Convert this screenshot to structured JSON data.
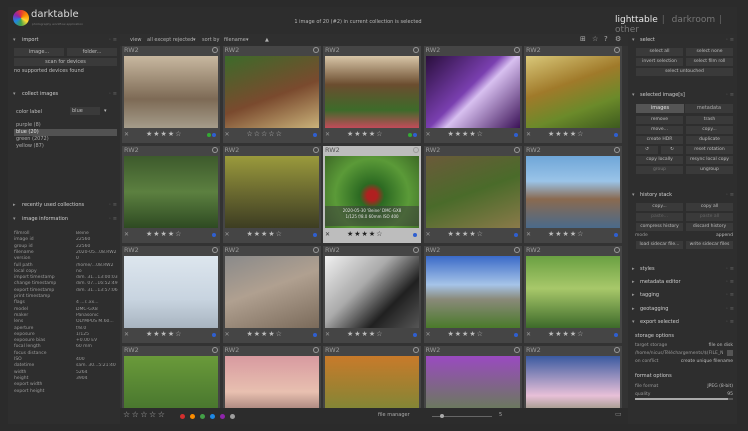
{
  "app": {
    "name": "darktable",
    "tagline": "photography workflow application"
  },
  "status_text": "1 image of 20 (#2) in current collection is selected",
  "views": [
    "lighttable",
    "darkroom",
    "other"
  ],
  "left": {
    "import": {
      "title": "import",
      "image_btn": "image...",
      "folder_btn": "folder...",
      "scan_btn": "scan for devices",
      "note": "no supported devices found"
    },
    "collect": {
      "title": "collect images",
      "mode": "color label",
      "value": "blue",
      "items": [
        "purple (8)",
        "blue (20)",
        "green (2072)",
        "yellow (87)"
      ]
    },
    "recent": {
      "title": "recently used collections"
    },
    "info": {
      "title": "image information",
      "rows": [
        [
          "filmroll",
          "Beine"
        ],
        [
          "image id",
          "22560"
        ],
        [
          "group id",
          "22560"
        ],
        [
          "filename",
          "2020-05...08.RW2"
        ],
        [
          "version",
          "0"
        ],
        [
          "full path",
          "/home/...08.RW2"
        ],
        [
          "local copy",
          "no"
        ],
        [
          "import timestamp",
          "dim. 31...13:00:03"
        ],
        [
          "change timestamp",
          "dim. 07...16:52:49"
        ],
        [
          "export timestamp",
          "dim. 31...13:57:06"
        ],
        [
          "print timestamp",
          ""
        ],
        [
          "flags",
          "4 ...r..xx..."
        ],
        [
          "model",
          "DMC-GX8"
        ],
        [
          "maker",
          "Panasonic"
        ],
        [
          "lens",
          "OLYMPUS M.60..."
        ],
        [
          "aperture",
          "f/8.0"
        ],
        [
          "exposure",
          "1/125"
        ],
        [
          "exposure bias",
          "+0.00 EV"
        ],
        [
          "focal length",
          "60 mm"
        ],
        [
          "focus distance",
          ""
        ],
        [
          "ISO",
          "400"
        ],
        [
          "datetime",
          "sam. 30...5:21:40"
        ],
        [
          "width",
          "5264"
        ],
        [
          "height",
          "3904"
        ],
        [
          "export width",
          ""
        ],
        [
          "export height",
          ""
        ]
      ]
    }
  },
  "toolbar": {
    "view_label": "view",
    "view_value": "all except rejected",
    "sort_label": "sort by",
    "sort_value": "filename",
    "sort_dir": "▲"
  },
  "thumbs": [
    {
      "fmt": "RW2",
      "rating": 4,
      "colors": [
        "#33aa33",
        "#2f5fd0"
      ],
      "bg": "linear-gradient(180deg,#c8b8a0,#7d6a55 60%,#a59c8a)"
    },
    {
      "fmt": "RW2",
      "rating": 0,
      "colors": [
        "#2f5fd0"
      ],
      "bg": "linear-gradient(160deg,#3c6b2a,#7a4a2e 55%,#c9b27a)"
    },
    {
      "fmt": "RW2",
      "rating": 4,
      "colors": [
        "#33aa33",
        "#2f5fd0"
      ],
      "bg": "linear-gradient(180deg,#d8c6a8,#6b4d2f 40%,#3d6b2a 75%,#c24b5a)"
    },
    {
      "fmt": "RW2",
      "rating": 4,
      "colors": [
        "#2f5fd0"
      ],
      "bg": "linear-gradient(135deg,#2a0f3d,#7a3fb0 45%,#d8c0f0 55%,#3b1257)"
    },
    {
      "fmt": "RW2",
      "rating": 4,
      "colors": [
        "#2f5fd0"
      ],
      "bg": "linear-gradient(160deg,#d9c87a,#a07a2a 40%,#6b8a2a 70%,#3d5a1e)"
    },
    {
      "fmt": "RW2",
      "rating": 4,
      "colors": [
        "#2f5fd0"
      ],
      "bg": "linear-gradient(180deg,#3d5a2c,#5c8040 50%,#2e4a22)"
    },
    {
      "fmt": "RW2",
      "rating": 4,
      "colors": [
        "#2f5fd0"
      ],
      "bg": "linear-gradient(180deg,#9a9a3c,#6b6a30 50%,#3d3d22)"
    },
    {
      "fmt": "RW2",
      "rating": 4,
      "colors": [
        "#2f5fd0"
      ],
      "bg": "radial-gradient(circle at 50% 55%,#b02020 8%,#2c6a22 20%,#5b9a38 60%,#3d6a26)",
      "hover": true,
      "overlay1": "2020-05-30 'Beine' DMC-GX8",
      "overlay2": "1/125 f/8.0 60mm ISO 400"
    },
    {
      "fmt": "RW2",
      "rating": 4,
      "colors": [
        "#2f5fd0"
      ],
      "bg": "linear-gradient(160deg,#6b5a3a,#4a6b2a 50%,#8a7a4a)"
    },
    {
      "fmt": "RW2",
      "rating": 4,
      "colors": [
        "#2f5fd0"
      ],
      "bg": "linear-gradient(180deg,#6fa6d8,#9ac4e8 35%,#8a6a50 60%,#4a6a8a)"
    },
    {
      "fmt": "RW2",
      "rating": 4,
      "colors": [
        "#2f5fd0"
      ],
      "bg": "linear-gradient(180deg,#dde6ee,#c8d4e0 60%,#a8b4c0)"
    },
    {
      "fmt": "RW2",
      "rating": 4,
      "colors": [
        "#2f5fd0"
      ],
      "bg": "linear-gradient(160deg,#8a8a8a,#b0a090 45%,#7a6a5a)"
    },
    {
      "fmt": "RW2",
      "rating": 4,
      "colors": [
        "#2f5fd0"
      ],
      "bg": "linear-gradient(135deg,#f0f0f0,#aaaaaa 40%,#202020 70%,#555)"
    },
    {
      "fmt": "RW2",
      "rating": 4,
      "colors": [
        "#2f5fd0"
      ],
      "bg": "linear-gradient(180deg,#3a6ac8,#a6c4e8 40%,#8a8a7a 60%,#4a7a2a)"
    },
    {
      "fmt": "RW2",
      "rating": 4,
      "colors": [
        "#2f5fd0"
      ],
      "bg": "linear-gradient(180deg,#6aa042,#a8c86a 45%,#3d6a2a)"
    },
    {
      "fmt": "RW2",
      "rating": 0,
      "colors": [],
      "bg": "linear-gradient(180deg,#6a9a3a,#3d6a2a)"
    },
    {
      "fmt": "RW2",
      "rating": 0,
      "colors": [],
      "bg": "linear-gradient(180deg,#d89aa0,#e8c0b0 50%,#6a4a4a)"
    },
    {
      "fmt": "RW2",
      "rating": 0,
      "colors": [],
      "bg": "linear-gradient(180deg,#c87a2a,#6a8a3a)"
    },
    {
      "fmt": "RW2",
      "rating": 0,
      "colors": [],
      "bg": "linear-gradient(180deg,#9a4ac0,#5a8a3a)"
    },
    {
      "fmt": "RW2",
      "rating": 0,
      "colors": [],
      "bg": "linear-gradient(180deg,#3a5aa0,#e8c0d8 55%,#4a6a2a)"
    }
  ],
  "bottom": {
    "layout": "file manager",
    "zoom": "5",
    "colors": [
      "#d32f2f",
      "#fb8c00",
      "#43a047",
      "#1e88e5",
      "#8e24aa",
      "#9e9e9e"
    ]
  },
  "right": {
    "select": {
      "title": "select",
      "all": "select all",
      "none": "select none",
      "invert": "invert selection",
      "film": "select film roll",
      "untouched": "select untouched"
    },
    "selected": {
      "title": "selected image[s]",
      "tab_images": "images",
      "tab_meta": "metadata",
      "buttons": [
        "remove",
        "trash",
        "move...",
        "copy...",
        "create HDR",
        "duplicate",
        "↺",
        "↻",
        "reset rotation",
        "copy locally",
        "resync local copy",
        "group",
        "ungroup"
      ]
    },
    "history": {
      "title": "history stack",
      "copy": "copy...",
      "copy_all": "copy all",
      "paste": "paste...",
      "paste_all": "paste all",
      "compress": "compress history",
      "discard": "discard history",
      "mode_label": "mode",
      "mode_value": "append",
      "load": "load sidecar file...",
      "write": "write sidecar files"
    },
    "styles": "styles",
    "metadata_editor": "metadata editor",
    "tagging": "tagging",
    "geotagging": "geotagging",
    "export": {
      "title": "export selected",
      "storage_head": "storage options",
      "target_label": "target storage",
      "target_value": "file on disk",
      "path": "/home/nicus/Téléchargements/$(FILE_N",
      "conflict_label": "on conflict",
      "conflict_value": "create unique filename",
      "format_head": "format options",
      "format_label": "file format",
      "format_value": "JPEG (8-bit)",
      "quality_label": "quality",
      "quality_value": "95"
    }
  }
}
